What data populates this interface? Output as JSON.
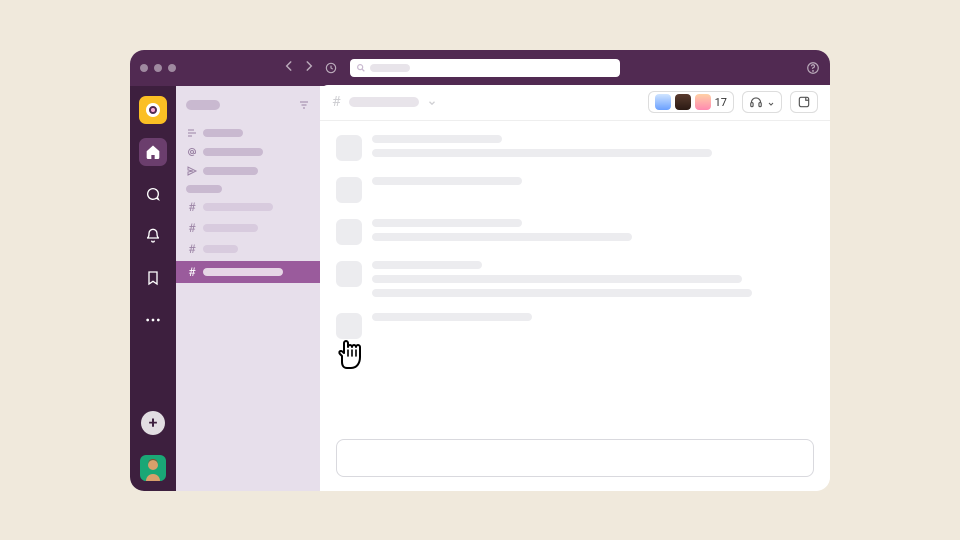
{
  "header": {
    "search_placeholder": "",
    "member_count": "17"
  },
  "sidebar": {
    "workspace_name": "",
    "nav_items": [
      "",
      "",
      ""
    ],
    "section_label": "",
    "channels": [
      "",
      "",
      "",
      ""
    ],
    "active_index": 3
  },
  "messages": {
    "line_widths": [
      [
        130,
        340
      ],
      [
        150
      ],
      [
        150,
        260
      ],
      [
        110,
        370,
        380
      ],
      [
        160
      ]
    ]
  },
  "icons": {
    "home": "home-icon",
    "dm": "dm-icon",
    "activity": "activity-icon",
    "bookmark": "bookmark-icon",
    "more": "more-icon",
    "add": "add-icon",
    "help": "help-icon",
    "history": "history-icon",
    "headphones": "headphones-icon",
    "canvas": "canvas-icon"
  }
}
